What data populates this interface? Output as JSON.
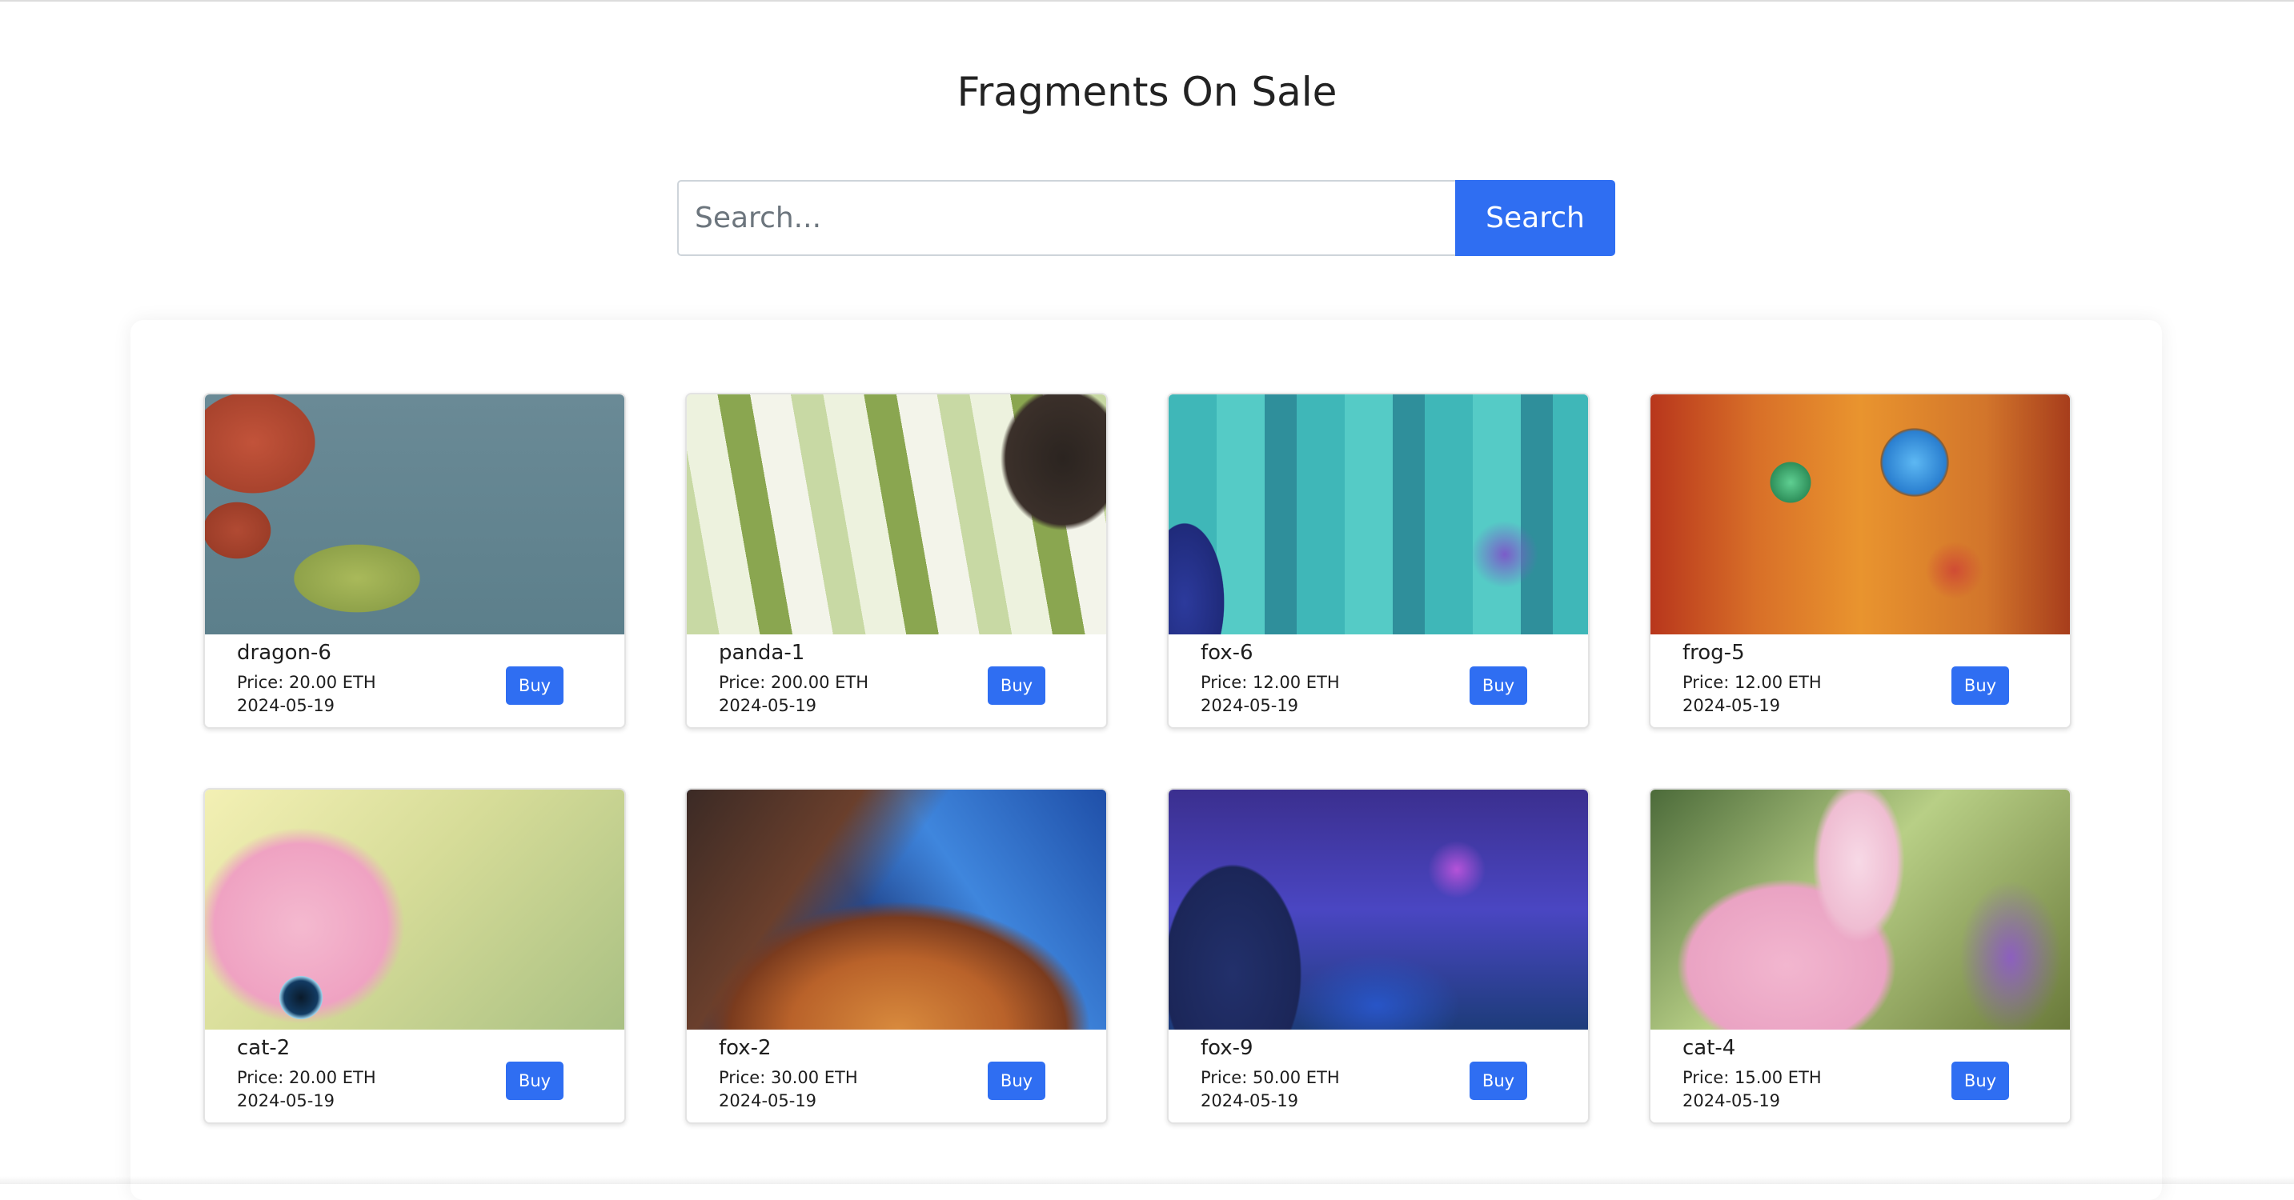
{
  "page": {
    "title": "Fragments On Sale"
  },
  "search": {
    "placeholder": "Search...",
    "value": "",
    "button_label": "Search"
  },
  "listings": [
    {
      "name": "dragon-6",
      "price": "Price: 20.00 ETH",
      "date": "2024-05-19",
      "buy_label": "Buy",
      "image": "dragon artwork"
    },
    {
      "name": "panda-1",
      "price": "Price: 200.00 ETH",
      "date": "2024-05-19",
      "buy_label": "Buy",
      "image": "panda artwork"
    },
    {
      "name": "fox-6",
      "price": "Price: 12.00 ETH",
      "date": "2024-05-19",
      "buy_label": "Buy",
      "image": "fox artwork"
    },
    {
      "name": "frog-5",
      "price": "Price: 12.00 ETH",
      "date": "2024-05-19",
      "buy_label": "Buy",
      "image": "frog artwork"
    },
    {
      "name": "cat-2",
      "price": "Price: 20.00 ETH",
      "date": "2024-05-19",
      "buy_label": "Buy",
      "image": "cat artwork"
    },
    {
      "name": "fox-2",
      "price": "Price: 30.00 ETH",
      "date": "2024-05-19",
      "buy_label": "Buy",
      "image": "fox artwork"
    },
    {
      "name": "fox-9",
      "price": "Price: 50.00 ETH",
      "date": "2024-05-19",
      "buy_label": "Buy",
      "image": "fox artwork"
    },
    {
      "name": "cat-4",
      "price": "Price: 15.00 ETH",
      "date": "2024-05-19",
      "buy_label": "Buy",
      "image": "cat artwork"
    }
  ],
  "colors": {
    "accent": "#2f6ef2",
    "text": "#212529",
    "background": "#ffffff"
  }
}
